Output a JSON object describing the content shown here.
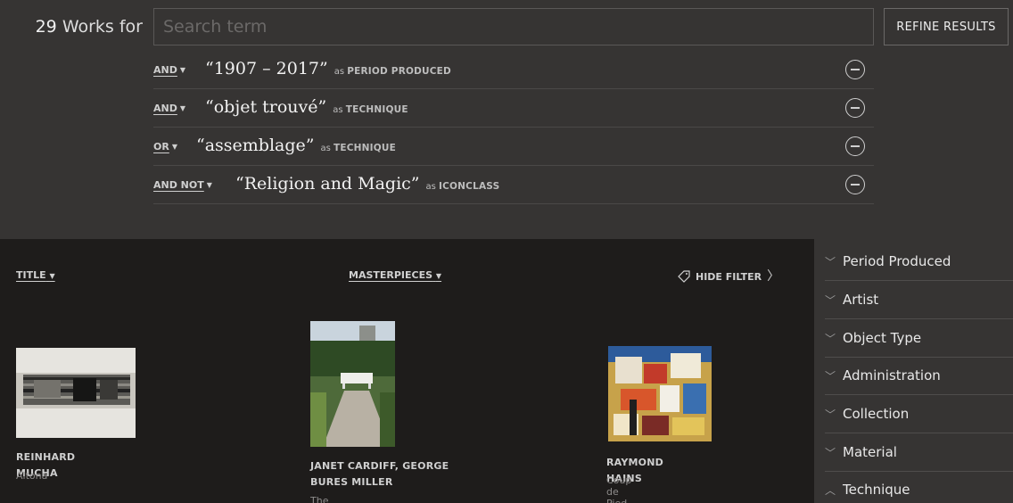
{
  "header": {
    "count": "29",
    "count_suffix": "Works for",
    "search_placeholder": "Search term",
    "refine_label": "REFINE RESULTS"
  },
  "criteria": [
    {
      "operator": "AND",
      "term": "“1907 – 2017”",
      "as": "as",
      "field": "PERIOD PRODUCED"
    },
    {
      "operator": "AND",
      "term": "“objet trouvé”",
      "as": "as",
      "field": "TECHNIQUE"
    },
    {
      "operator": "OR",
      "term": "“assemblage”",
      "as": "as",
      "field": "TECHNIQUE"
    },
    {
      "operator": "AND NOT",
      "term": "“Religion and Magic”",
      "as": "as",
      "field": "ICONCLASS"
    }
  ],
  "sortbar": {
    "sort_label": "TITLE",
    "masterpieces_label": "MASTERPIECES",
    "hide_filter_label": "HIDE FILTER"
  },
  "works": [
    {
      "artist": "REINHARD MUCHA",
      "title": "Altona"
    },
    {
      "artist": "JANET CARDIFF, GEORGE BURES MILLER",
      "title": "The Bench"
    },
    {
      "artist": "RAYMOND HAINS",
      "title": "Coup de Pied"
    }
  ],
  "filters": [
    {
      "label": "Period Produced",
      "expanded": false
    },
    {
      "label": "Artist",
      "expanded": false
    },
    {
      "label": "Object Type",
      "expanded": false
    },
    {
      "label": "Administration",
      "expanded": false
    },
    {
      "label": "Collection",
      "expanded": false
    },
    {
      "label": "Material",
      "expanded": false
    },
    {
      "label": "Technique",
      "expanded": true
    }
  ],
  "colors": {
    "header_bg": "#363433",
    "page_bg": "#1e1c1b",
    "text": "#eeeeee"
  }
}
